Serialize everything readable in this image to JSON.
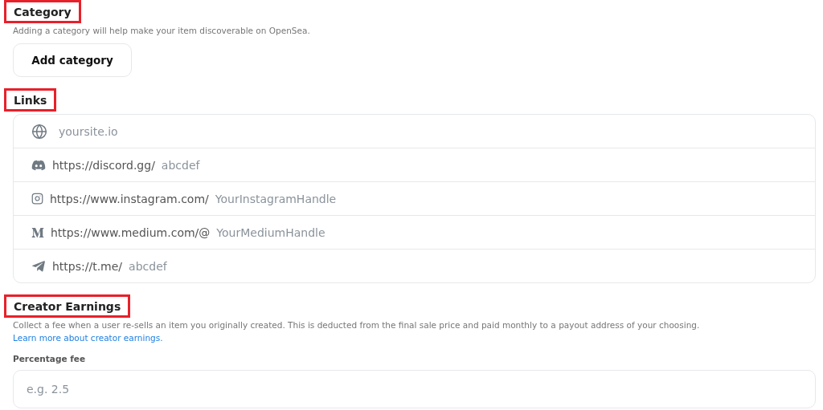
{
  "category": {
    "title": "Category",
    "highlighted": true,
    "description": "Adding a category will help make your item discoverable on OpenSea.",
    "button": "Add category"
  },
  "links": {
    "title": "Links",
    "highlighted": true,
    "rows": [
      {
        "placeholder": "yoursite.io"
      },
      {
        "prefix": "https://discord.gg/",
        "placeholder": "abcdef"
      },
      {
        "prefix": "https://www.instagram.com/",
        "placeholder": "YourInstagramHandle"
      },
      {
        "prefix": "https://www.medium.com/@",
        "placeholder": "YourMediumHandle"
      },
      {
        "prefix": "https://t.me/",
        "placeholder": "abcdef"
      }
    ]
  },
  "creator_earnings": {
    "title": "Creator Earnings",
    "highlighted": true,
    "description": "Collect a fee when a user re-sells an item you originally created. This is deducted from the final sale price and paid monthly to a payout address of your choosing.",
    "link": "Learn more about creator earnings.",
    "field_label": "Percentage fee",
    "placeholder": "e.g. 2.5"
  }
}
